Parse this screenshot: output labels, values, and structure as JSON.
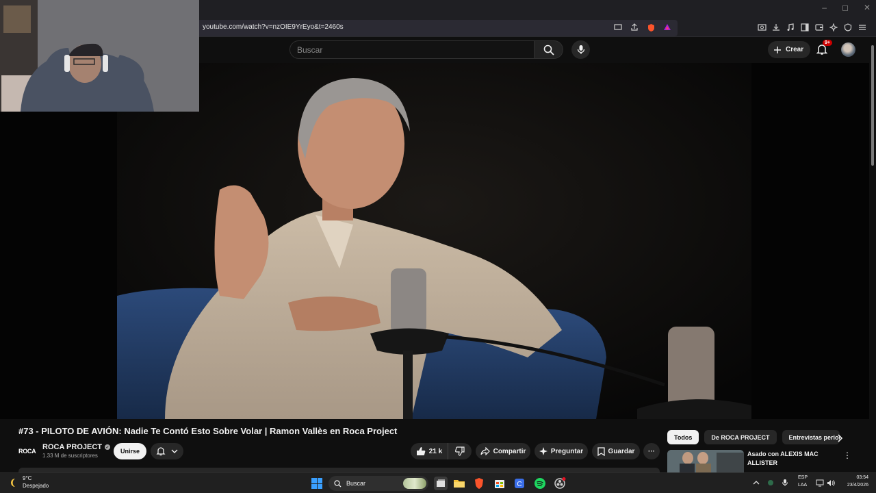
{
  "browser": {
    "url": "youtube.com/watch?v=nzOIE9YrEyo&t=2460s",
    "window_controls": [
      "–",
      "◻",
      "✕"
    ]
  },
  "youtube_header": {
    "search_placeholder": "Buscar",
    "create_label": "Crear",
    "notifications_badge": "9+"
  },
  "video": {
    "title": "#73 - PILOTO DE AVIÓN: Nadie Te Contó Esto Sobre Volar | Ramon Vallès en Roca Project",
    "channel_logo_text": "ROCA",
    "channel_name": "ROCA PROJECT",
    "subscribers": "1.33 M de suscriptores",
    "join_label": "Unirse",
    "likes": "21 k",
    "share_label": "Compartir",
    "ask_label": "Preguntar",
    "save_label": "Guardar",
    "more_label": "···"
  },
  "sidebar": {
    "chips": [
      "Todos",
      "De ROCA PROJECT",
      "Entrevistas period"
    ],
    "recommended": [
      {
        "title": "Asado con ALEXIS MAC ALLISTER"
      }
    ]
  },
  "taskbar": {
    "temperature": "9°C",
    "weather": "Despejado",
    "search_label": "Buscar",
    "lang_line1": "ESP",
    "lang_line2": "LAA",
    "time": "03:54",
    "date": "23/4/2026"
  },
  "colors": {
    "background": "#0f0f0f",
    "pill": "#272727",
    "text": "#f1f1f1",
    "badge": "#cc0000",
    "brave_orange": "#fb542b",
    "spotify_green": "#1ed760"
  }
}
